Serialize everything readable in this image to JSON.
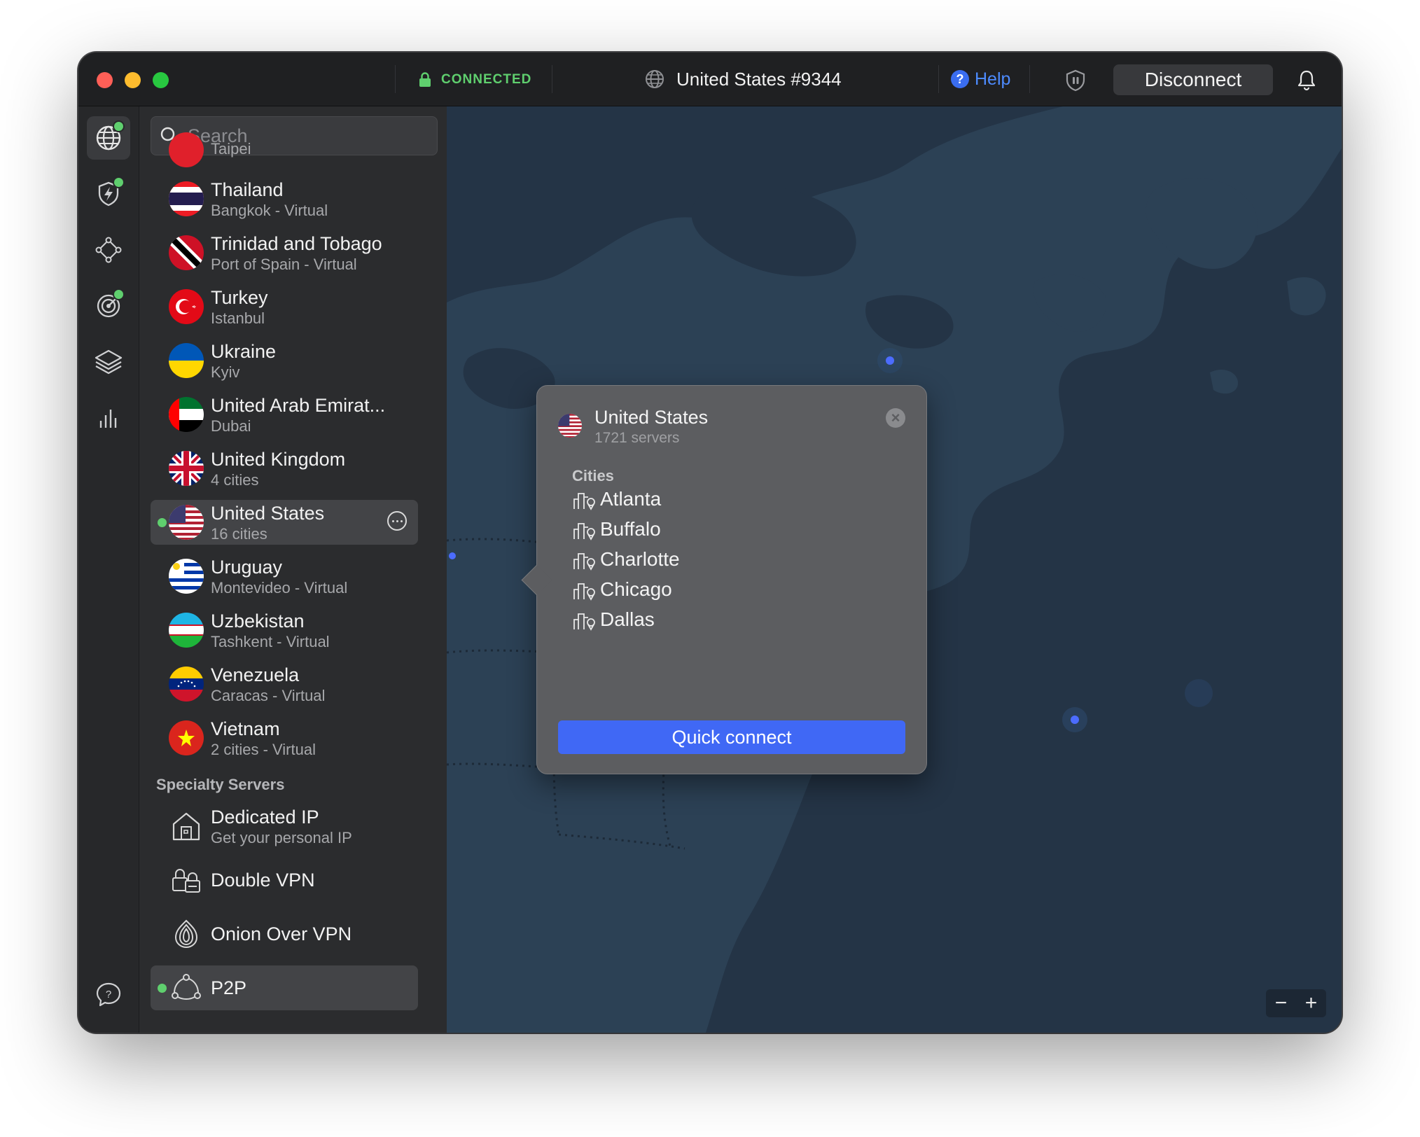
{
  "titlebar": {
    "status": "CONNECTED",
    "server": "United States #9344",
    "help": "Help",
    "disconnect": "Disconnect"
  },
  "search": {
    "placeholder": "Search"
  },
  "countries": [
    {
      "name": "Taipei",
      "sub": "",
      "flag": "taiwan"
    },
    {
      "name": "Thailand",
      "sub": "Bangkok - Virtual",
      "flag": "thailand"
    },
    {
      "name": "Trinidad and Tobago",
      "sub": "Port of Spain - Virtual",
      "flag": "trinidad"
    },
    {
      "name": "Turkey",
      "sub": "Istanbul",
      "flag": "turkey"
    },
    {
      "name": "Ukraine",
      "sub": "Kyiv",
      "flag": "ukraine"
    },
    {
      "name": "United Arab Emirat...",
      "sub": "Dubai",
      "flag": "uae"
    },
    {
      "name": "United Kingdom",
      "sub": "4 cities",
      "flag": "uk"
    },
    {
      "name": "United States",
      "sub": "16 cities",
      "flag": "us",
      "selected": true
    },
    {
      "name": "Uruguay",
      "sub": "Montevideo - Virtual",
      "flag": "uruguay"
    },
    {
      "name": "Uzbekistan",
      "sub": "Tashkent - Virtual",
      "flag": "uzbekistan"
    },
    {
      "name": "Venezuela",
      "sub": "Caracas - Virtual",
      "flag": "venezuela"
    },
    {
      "name": "Vietnam",
      "sub": "2 cities - Virtual",
      "flag": "vietnam"
    }
  ],
  "specialty": {
    "title": "Specialty Servers",
    "items": [
      {
        "name": "Dedicated IP",
        "sub": "Get your personal IP",
        "icon": "house-icon"
      },
      {
        "name": "Double VPN",
        "sub": "",
        "icon": "double-lock-icon"
      },
      {
        "name": "Onion Over VPN",
        "sub": "",
        "icon": "onion-icon"
      },
      {
        "name": "P2P",
        "sub": "",
        "icon": "p2p-icon"
      }
    ]
  },
  "popover": {
    "title": "United States",
    "servers": "1721 servers",
    "cities_label": "Cities",
    "cities": [
      "Atlanta",
      "Buffalo",
      "Charlotte",
      "Chicago",
      "Dallas"
    ],
    "quick_connect": "Quick connect"
  },
  "colors": {
    "accent": "#4068f5",
    "connected": "#5fcf6e",
    "map_water": "#243446",
    "map_land": "#2c4155"
  }
}
